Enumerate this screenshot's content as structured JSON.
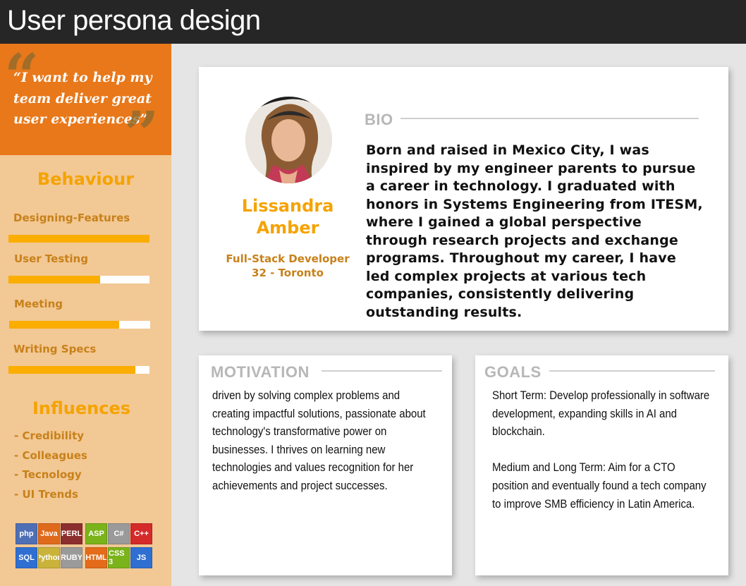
{
  "header": {
    "title": "User persona design"
  },
  "sidebar": {
    "quote": "“I want to help my team deliver great user experiences”",
    "quote_open_mark": "“",
    "quote_close_mark": "”",
    "behaviour_heading": "Behaviour",
    "skills": [
      {
        "label": "Designing-Features",
        "level": 1.0
      },
      {
        "label": "User Testing",
        "level": 0.65
      },
      {
        "label": "Meeting",
        "level": 0.78
      },
      {
        "label": "Writing Specs",
        "level": 0.9
      }
    ],
    "influences_heading": "Influences",
    "influences": [
      "- Credibility",
      "- Colleagues",
      "- Tecnology",
      "- UI Trends"
    ],
    "tech_icons": [
      {
        "name": "php-icon",
        "label": "php",
        "color": "#4f6fb5"
      },
      {
        "name": "java-icon",
        "label": "Java",
        "color": "#e06a1b"
      },
      {
        "name": "perl-icon",
        "label": "PERL",
        "color": "#8d2e2e"
      },
      {
        "name": "asp-icon",
        "label": "ASP",
        "color": "#7bb31a"
      },
      {
        "name": "csharp-icon",
        "label": "C#",
        "color": "#9a9a9a"
      },
      {
        "name": "cplusplus-icon",
        "label": "C++",
        "color": "#d42a2a"
      },
      {
        "name": "sql-icon",
        "label": "SQL",
        "color": "#2f6fd1"
      },
      {
        "name": "python-icon",
        "label": "Python",
        "color": "#c9b33a"
      },
      {
        "name": "ruby-icon",
        "label": "RUBY",
        "color": "#9a9a9a"
      },
      {
        "name": "html-icon",
        "label": "HTML",
        "color": "#e36b1a"
      },
      {
        "name": "css-icon",
        "label": "CSS 3",
        "color": "#7bb31a"
      },
      {
        "name": "js-icon",
        "label": "JS",
        "color": "#2f6fd1"
      }
    ]
  },
  "profile": {
    "name": "Lissandra Amber",
    "role": "Full-Stack Developer",
    "meta": "32 - Toronto"
  },
  "bio": {
    "label": "BIO",
    "text": "Born and raised in Mexico City, I was inspired by my engineer parents to pursue a career in technology. I graduated with honors in Systems Engineering from ITESM, where I gained a global perspective through research projects and exchange programs. Throughout my career, I have led complex projects at various tech companies, consistently delivering outstanding results."
  },
  "motivation": {
    "label": "MOTIVATION",
    "text": "driven by solving complex problems and creating impactful solutions, passionate about technology's transformative power on businesses. I thrives on learning new technologies and values recognition for her achievements and project successes."
  },
  "goals": {
    "label": "GOALS",
    "short_term": "Short Term: Develop professionally in software development, expanding skills in AI and blockchain.",
    "long_term": "Medium and Long Term: Aim for a CTO position and eventually found a tech company to improve SMB efficiency in Latin America."
  }
}
